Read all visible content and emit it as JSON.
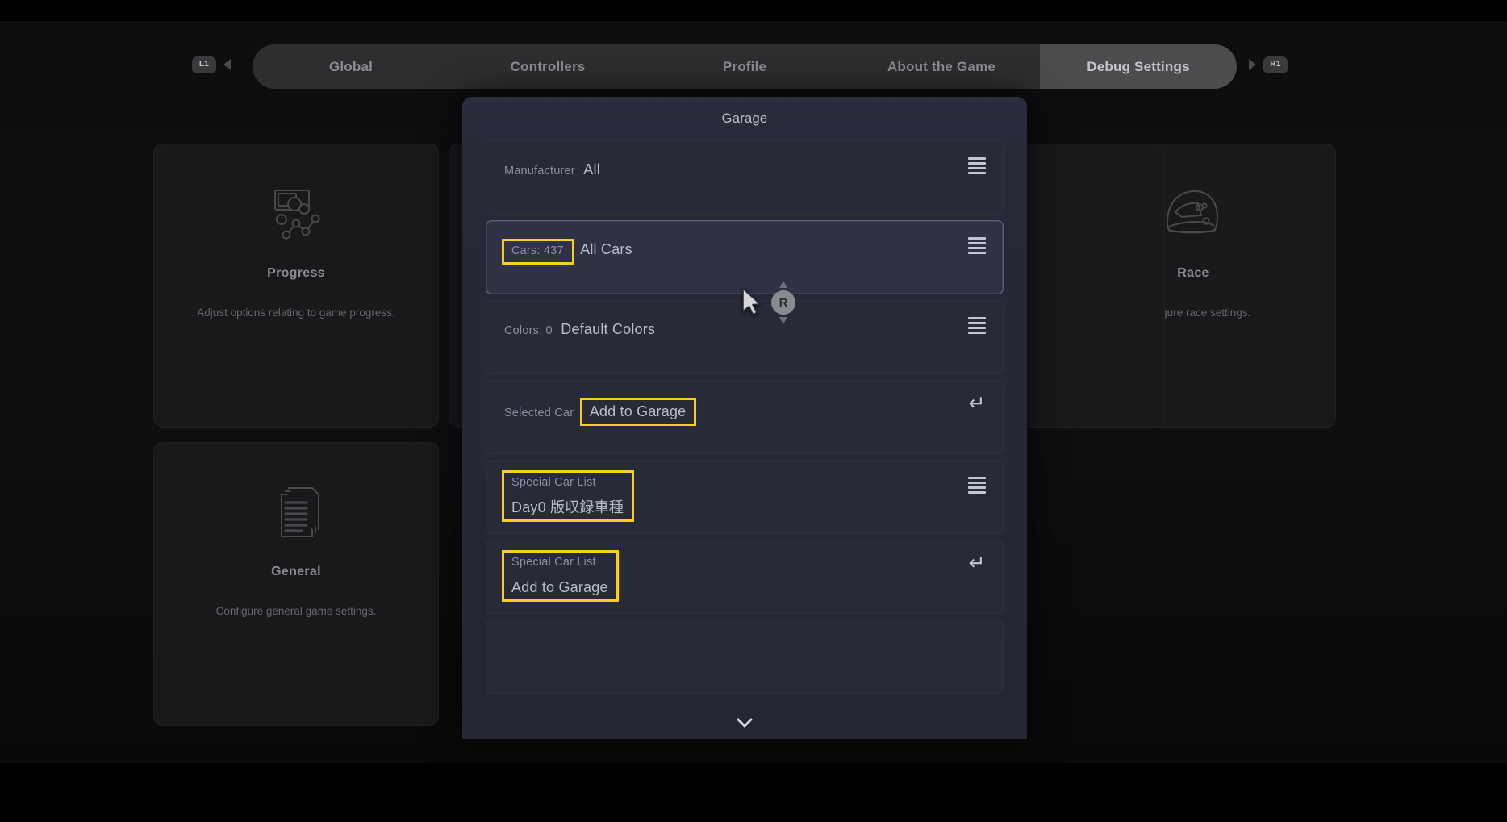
{
  "tabbar": {
    "prev_button_glyph": "L1",
    "next_button_glyph": "R1",
    "tabs": [
      {
        "label": "Global",
        "active": false
      },
      {
        "label": "Controllers",
        "active": false
      },
      {
        "label": "Profile",
        "active": false
      },
      {
        "label": "About the Game",
        "active": false
      },
      {
        "label": "Debug Settings",
        "active": true
      }
    ]
  },
  "cards": [
    {
      "title": "Progress",
      "desc": "Adjust options relating to game progress.",
      "icon": "progress-graph-icon"
    },
    {
      "title": "General",
      "desc": "Configure general game settings.",
      "icon": "documents-stack-icon"
    },
    {
      "title": "Race",
      "desc": "Configure race settings.",
      "icon": "racing-helmet-icon"
    }
  ],
  "dialog": {
    "title": "Garage",
    "scroll_down_glyph": "⌄",
    "rows": [
      {
        "label": "Manufacturer",
        "value": "All",
        "action_icon": "list-menu-icon",
        "selected": false,
        "label_highlighted": false,
        "value_highlighted": false
      },
      {
        "label": "Cars: 437",
        "value": "All Cars",
        "action_icon": "list-menu-icon",
        "selected": true,
        "label_highlighted": true,
        "value_highlighted": false
      },
      {
        "label": "Colors: 0",
        "value": "Default Colors",
        "action_icon": "list-menu-icon",
        "selected": false,
        "label_highlighted": false,
        "value_highlighted": false
      },
      {
        "label": "Selected Car",
        "value": "Add to Garage",
        "action_icon": "return-arrow-icon",
        "selected": false,
        "label_highlighted": false,
        "value_highlighted": true
      },
      {
        "label": "Special Car List",
        "value": "Day0 版収録車種",
        "action_icon": "list-menu-icon",
        "selected": false,
        "label_highlighted": true,
        "value_highlighted": true,
        "group_highlighted": true
      },
      {
        "label": "Special Car List",
        "value": "Add to Garage",
        "action_icon": "return-arrow-icon",
        "selected": false,
        "label_highlighted": true,
        "value_highlighted": true,
        "group_highlighted": true
      }
    ]
  },
  "cursor": {
    "scroll_badge_label": "R"
  },
  "colors": {
    "highlight": "#f2d024",
    "dialog_bg": "#272937",
    "row_bg": "#282a38",
    "row_selected_bg": "#2f3242",
    "accent_text": "#b9bcc9"
  }
}
